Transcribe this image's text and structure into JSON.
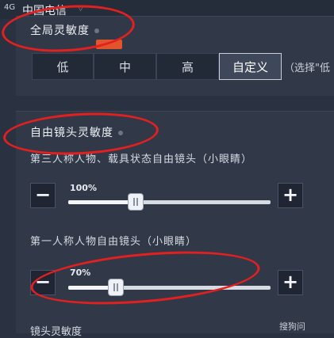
{
  "status_bar": {
    "signal": "4G",
    "carrier": "中国电信",
    "wifi_icon": "wifi-icon"
  },
  "global_sensitivity": {
    "title": "全局灵敏度",
    "options": [
      "低",
      "中",
      "高",
      "自定义"
    ],
    "selected": "自定义",
    "hint": "（选择\"低"
  },
  "free_look": {
    "title": "自由镜头灵敏度",
    "settings": [
      {
        "label": "第三人称人物、载具状态自由镜头（小眼睛）",
        "percent_label": "100%",
        "value": 100,
        "max": 300
      },
      {
        "label": "第一人称人物自由镜头（小眼睛）",
        "percent_label": "70%",
        "value": 70,
        "max": 300
      }
    ],
    "minus": "−",
    "plus": "+"
  },
  "bottom_peek": "镜头灵敏度",
  "watermark": "搜狗问",
  "colors": {
    "accent": "#e32020",
    "panel": "#313848",
    "background": "#2a3140"
  }
}
